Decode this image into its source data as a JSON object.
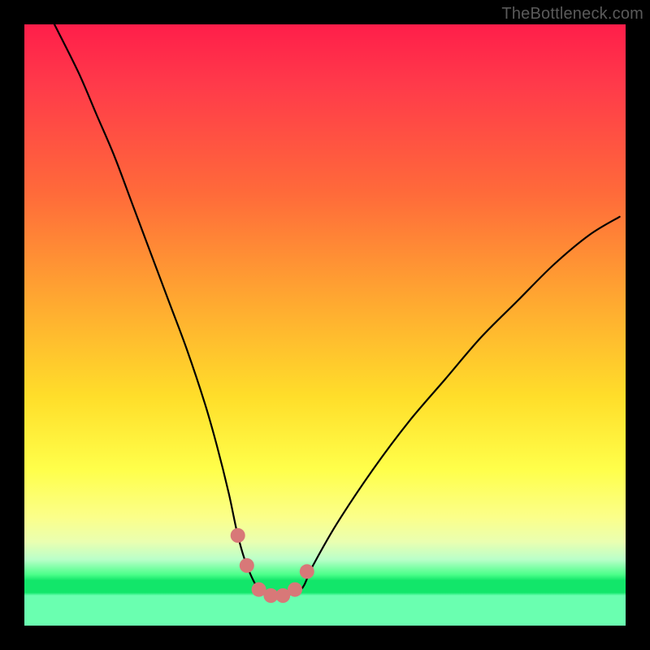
{
  "watermark": "TheBottleneck.com",
  "chart_data": {
    "type": "line",
    "title": "",
    "xlabel": "",
    "ylabel": "",
    "xlim": [
      0,
      100
    ],
    "ylim": [
      0,
      100
    ],
    "grid": false,
    "legend": false,
    "series": [
      {
        "name": "bottleneck-curve",
        "x": [
          5,
          9,
          12,
          15,
          18,
          21,
          24,
          27,
          30,
          32,
          34,
          35.5,
          37,
          39,
          41,
          43,
          46,
          48,
          52,
          58,
          64,
          70,
          76,
          82,
          88,
          94,
          99
        ],
        "values": [
          100,
          92,
          85,
          78,
          70,
          62,
          54,
          46,
          37,
          30,
          22,
          15,
          10,
          6,
          5,
          5,
          6,
          10,
          17,
          26,
          34,
          41,
          48,
          54,
          60,
          65,
          68
        ]
      }
    ],
    "valley_markers": {
      "name": "valley-dots",
      "x": [
        35.5,
        37,
        39,
        41,
        43,
        45,
        47
      ],
      "values": [
        15,
        10,
        6,
        5,
        5,
        6,
        9
      ]
    },
    "background_gradient": {
      "stops": [
        {
          "pos": 0,
          "color": "#ff1e4a"
        },
        {
          "pos": 0.45,
          "color": "#ffa531"
        },
        {
          "pos": 0.74,
          "color": "#ffff4a"
        },
        {
          "pos": 0.93,
          "color": "#12e66a"
        },
        {
          "pos": 1.0,
          "color": "#6affb0"
        }
      ]
    },
    "curve_color": "#000000",
    "marker_color": "#d87878"
  }
}
